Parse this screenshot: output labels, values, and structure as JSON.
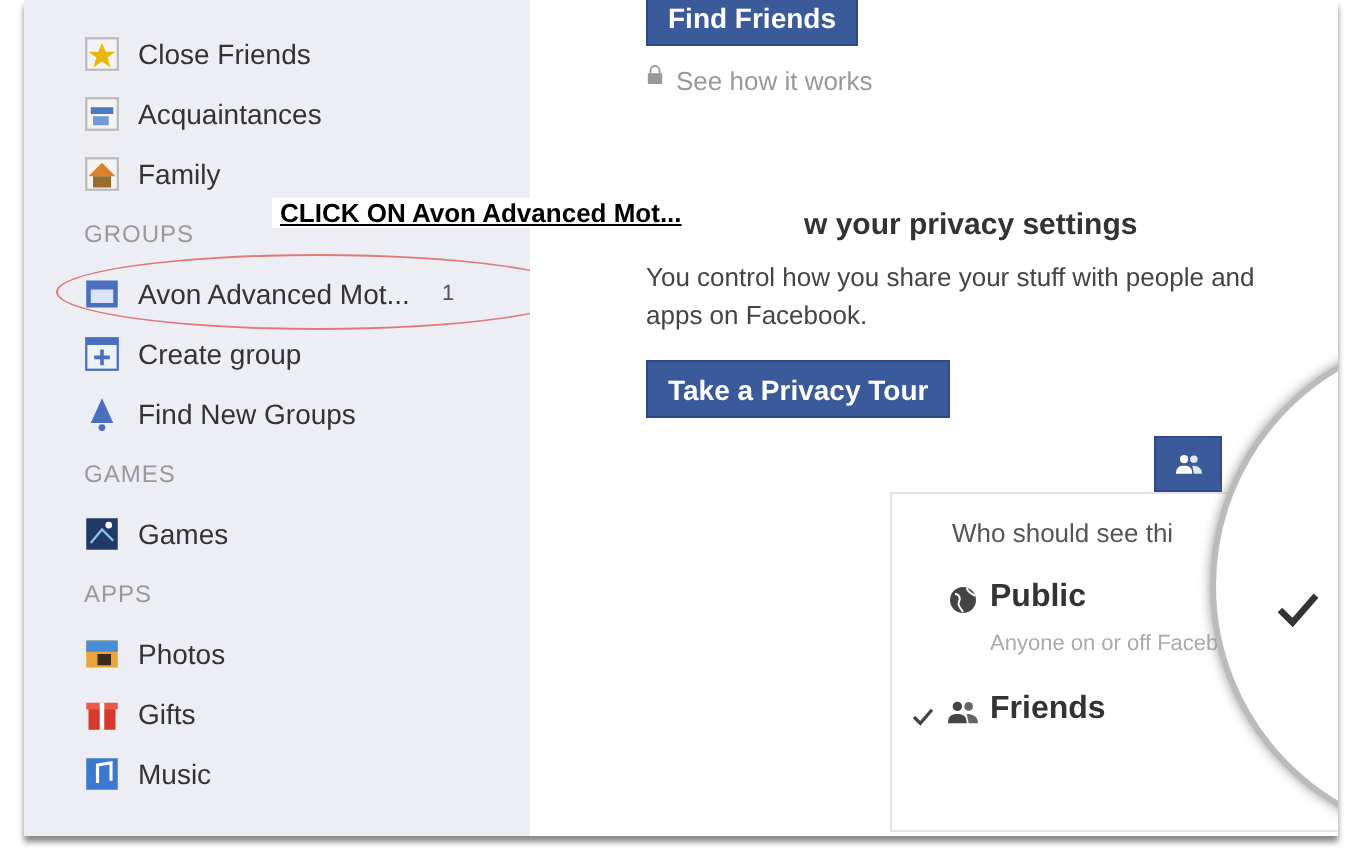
{
  "annotation": {
    "label": "CLICK ON Avon Advanced Mot..."
  },
  "sidebar": {
    "sections": [
      {
        "items": [
          {
            "label": "Close Friends"
          },
          {
            "label": "Acquaintances"
          },
          {
            "label": "Family"
          }
        ]
      },
      {
        "heading": "GROUPS",
        "items": [
          {
            "label": "Avon Advanced Mot...",
            "count": "1",
            "circled": true
          },
          {
            "label": "Create group"
          },
          {
            "label": "Find New Groups"
          }
        ]
      },
      {
        "heading": "GAMES",
        "items": [
          {
            "label": "Games"
          }
        ]
      },
      {
        "heading": "APPS",
        "items": [
          {
            "label": "Photos"
          },
          {
            "label": "Gifts"
          },
          {
            "label": "Music"
          }
        ]
      }
    ]
  },
  "main": {
    "find_friends_button": "Find Friends",
    "see_how_link": "See how it works",
    "privacy_heading": "w your privacy settings",
    "privacy_text": "You control how you share your stuff with people and apps on Facebook.",
    "tour_button": "Take a Privacy Tour",
    "audience": {
      "prompt": "Who should see thi",
      "options": [
        {
          "label": "Public",
          "description": "Anyone on or off Faceb",
          "selected": false
        },
        {
          "label": "Friends",
          "selected": true
        }
      ]
    }
  }
}
